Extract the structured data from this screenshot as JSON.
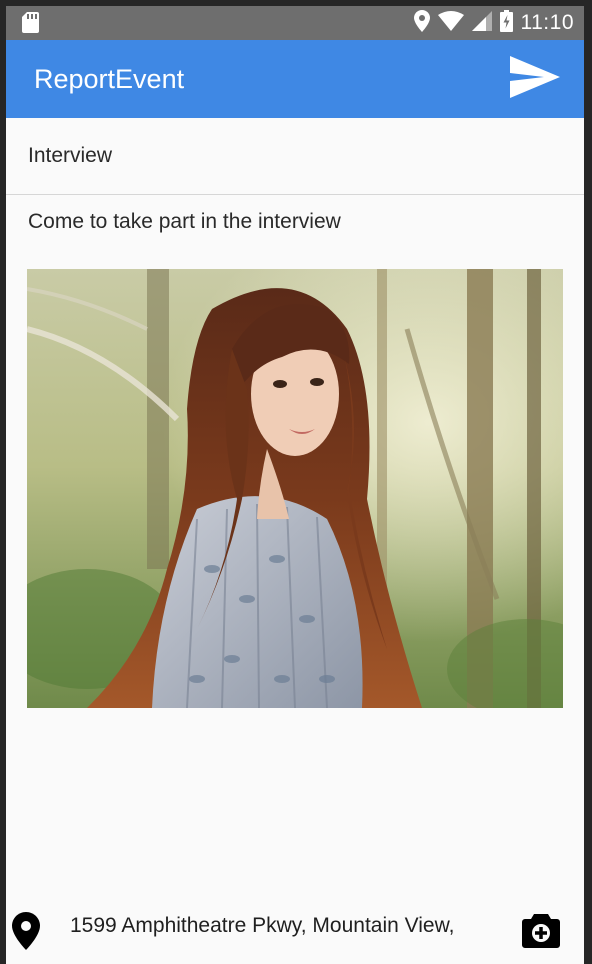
{
  "status_bar": {
    "time": "11:10",
    "icons": [
      "sd-card-icon",
      "location-pin-icon",
      "wifi-icon",
      "cell-signal-icon",
      "battery-icon"
    ]
  },
  "app_bar": {
    "title": "ReportEvent",
    "background": "#3f88e4",
    "action_icon": "send-icon"
  },
  "event": {
    "title": "Interview",
    "description": "Come to take part in the interview",
    "photo_alt": "Photo of a woman with long auburn hair in a forest"
  },
  "footer": {
    "location_icon": "location-pin-icon",
    "address": "1599 Amphitheatre Pkwy,  Mountain View,",
    "camera_icon": "camera-icon"
  }
}
